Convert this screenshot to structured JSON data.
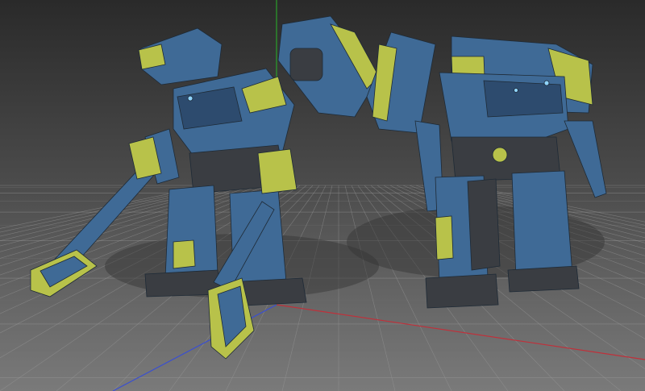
{
  "viewport": {
    "background_top": "#2a2a2a",
    "background_bottom": "#7a7a7a",
    "grid_color": "#9a9a9a",
    "grid_minor_color": "#6f6f6f"
  },
  "axes": {
    "x_color": "#c0303a",
    "y_color": "#2aa02a",
    "z_color": "#3a4fd0"
  },
  "mechs": {
    "armor_blue": "#3f6a96",
    "armor_blue_dark": "#2d4b6e",
    "armor_yellow": "#b8c24a",
    "armor_gray": "#3a3d42",
    "visor_glow": "#8fd4ff",
    "shadow_color": "#333333"
  }
}
